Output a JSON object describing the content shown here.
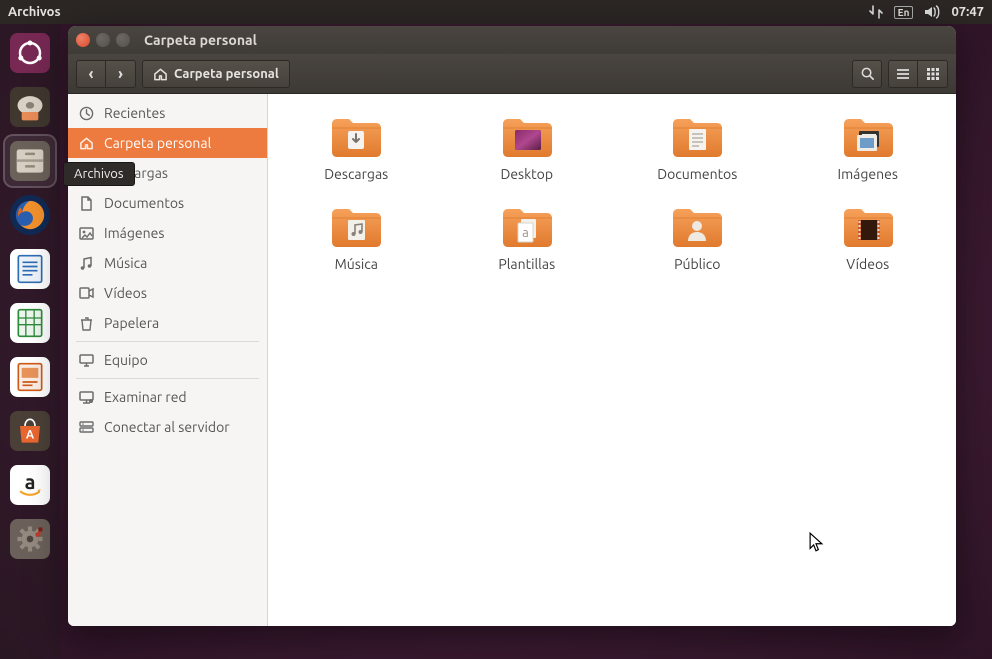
{
  "panel": {
    "active_app": "Archivos",
    "lang": "En",
    "clock": "07:47"
  },
  "tooltip": "Archivos",
  "window": {
    "title": "Carpeta personal",
    "path_label": "Carpeta personal"
  },
  "sidebar": [
    {
      "icon": "clock",
      "label": "Recientes"
    },
    {
      "icon": "home",
      "label": "Carpeta personal",
      "active": true
    },
    {
      "icon": "download",
      "label": "Descargas"
    },
    {
      "icon": "doc",
      "label": "Documentos"
    },
    {
      "icon": "image",
      "label": "Imágenes"
    },
    {
      "icon": "music",
      "label": "Música"
    },
    {
      "icon": "video",
      "label": "Vídeos"
    },
    {
      "icon": "trash",
      "label": "Papelera"
    },
    {
      "sep": true
    },
    {
      "icon": "computer",
      "label": "Equipo"
    },
    {
      "sep": true
    },
    {
      "icon": "network",
      "label": "Examinar red"
    },
    {
      "icon": "server",
      "label": "Conectar al servidor"
    }
  ],
  "folders": [
    {
      "label": "Descargas",
      "variant": "download"
    },
    {
      "label": "Desktop",
      "variant": "desktop"
    },
    {
      "label": "Documentos",
      "variant": "documents"
    },
    {
      "label": "Imágenes",
      "variant": "images"
    },
    {
      "label": "Música",
      "variant": "music"
    },
    {
      "label": "Plantillas",
      "variant": "templates"
    },
    {
      "label": "Público",
      "variant": "public"
    },
    {
      "label": "Vídeos",
      "variant": "videos"
    }
  ],
  "launcher": [
    {
      "name": "dash",
      "color": "#772953",
      "kind": "dash"
    },
    {
      "name": "ubiquity",
      "color": "#e88c58",
      "kind": "disk"
    },
    {
      "name": "files",
      "color": "#e1dbd1",
      "kind": "drawer",
      "active": true
    },
    {
      "name": "firefox",
      "color": "#1b52a4",
      "kind": "firefox"
    },
    {
      "name": "writer",
      "color": "#ffffff",
      "kind": "writer"
    },
    {
      "name": "calc",
      "color": "#ffffff",
      "kind": "calc"
    },
    {
      "name": "impress",
      "color": "#ffffff",
      "kind": "impress"
    },
    {
      "name": "software",
      "color": "#e8662f",
      "kind": "bag"
    },
    {
      "name": "amazon",
      "color": "#ffffff",
      "kind": "amazon"
    },
    {
      "name": "settings",
      "color": "#6b615a",
      "kind": "gear"
    }
  ]
}
